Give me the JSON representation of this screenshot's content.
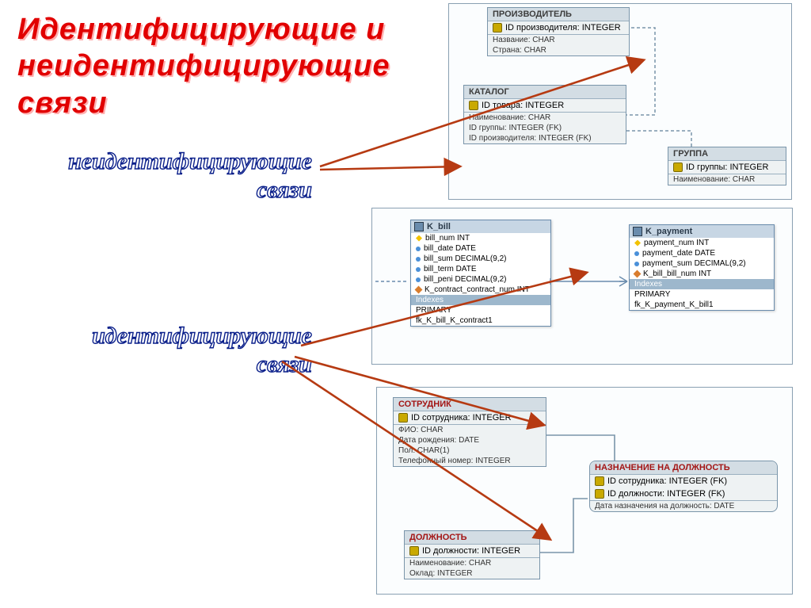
{
  "slide": {
    "title": "Идентифицирующие и\nнеидентифицирующие\nсвязи",
    "label_nonident_1": "неидентифицирующие",
    "label_nonident_2": "связи",
    "label_ident_1": "идентифицирующие",
    "label_ident_2": "связи"
  },
  "diagram_top": {
    "tables": {
      "manufacturer": {
        "title": "ПРОИЗВОДИТЕЛЬ",
        "keys": [
          "ID производителя: INTEGER"
        ],
        "attrs": [
          "Название: CHAR",
          "Страна: CHAR"
        ]
      },
      "catalog": {
        "title": "КАТАЛОГ",
        "keys": [
          "ID товара: INTEGER"
        ],
        "attrs": [
          "Наименование: CHAR",
          "ID группы: INTEGER (FK)",
          "ID производителя: INTEGER (FK)"
        ]
      },
      "group": {
        "title": "ГРУППА",
        "keys": [
          "ID группы: INTEGER"
        ],
        "attrs": [
          "Наименование: CHAR"
        ]
      }
    }
  },
  "diagram_mid": {
    "kbill": {
      "title": "K_bill",
      "cols": [
        {
          "icon": "key",
          "name": "bill_num INT"
        },
        {
          "icon": "dot",
          "name": "bill_date DATE"
        },
        {
          "icon": "dot",
          "name": "bill_sum DECIMAL(9,2)"
        },
        {
          "icon": "dot",
          "name": "bill_term DATE"
        },
        {
          "icon": "dot",
          "name": "bill_peni DECIMAL(9,2)"
        },
        {
          "icon": "fk",
          "name": "K_contract_contract_num INT"
        }
      ],
      "sections": [
        "Indexes"
      ],
      "indexes": [
        "PRIMARY",
        "fk_K_bill_K_contract1"
      ]
    },
    "kpayment": {
      "title": "K_payment",
      "cols": [
        {
          "icon": "key",
          "name": "payment_num INT"
        },
        {
          "icon": "dot",
          "name": "payment_date DATE"
        },
        {
          "icon": "dot",
          "name": "payment_sum DECIMAL(9,2)"
        },
        {
          "icon": "fk",
          "name": "K_bill_bill_num INT"
        }
      ],
      "sections": [
        "Indexes"
      ],
      "indexes": [
        "PRIMARY",
        "fk_K_payment_K_bill1"
      ]
    }
  },
  "diagram_bot": {
    "employee": {
      "title": "СОТРУДНИК",
      "keys": [
        "ID сотрудника: INTEGER"
      ],
      "attrs": [
        "ФИО: CHAR",
        "Дата рождения: DATE",
        "Пол: CHAR(1)",
        "Телефонный номер: INTEGER"
      ]
    },
    "assignment": {
      "title": "НАЗНАЧЕНИЕ НА ДОЛЖНОСТЬ",
      "keys": [
        "ID сотрудника: INTEGER (FK)",
        "ID должности: INTEGER (FK)"
      ],
      "attrs": [
        "Дата назначения на должность: DATE"
      ]
    },
    "position": {
      "title": "ДОЛЖНОСТЬ",
      "keys": [
        "ID должности: INTEGER"
      ],
      "attrs": [
        "Наименование: CHAR",
        "Оклад: INTEGER"
      ]
    }
  }
}
